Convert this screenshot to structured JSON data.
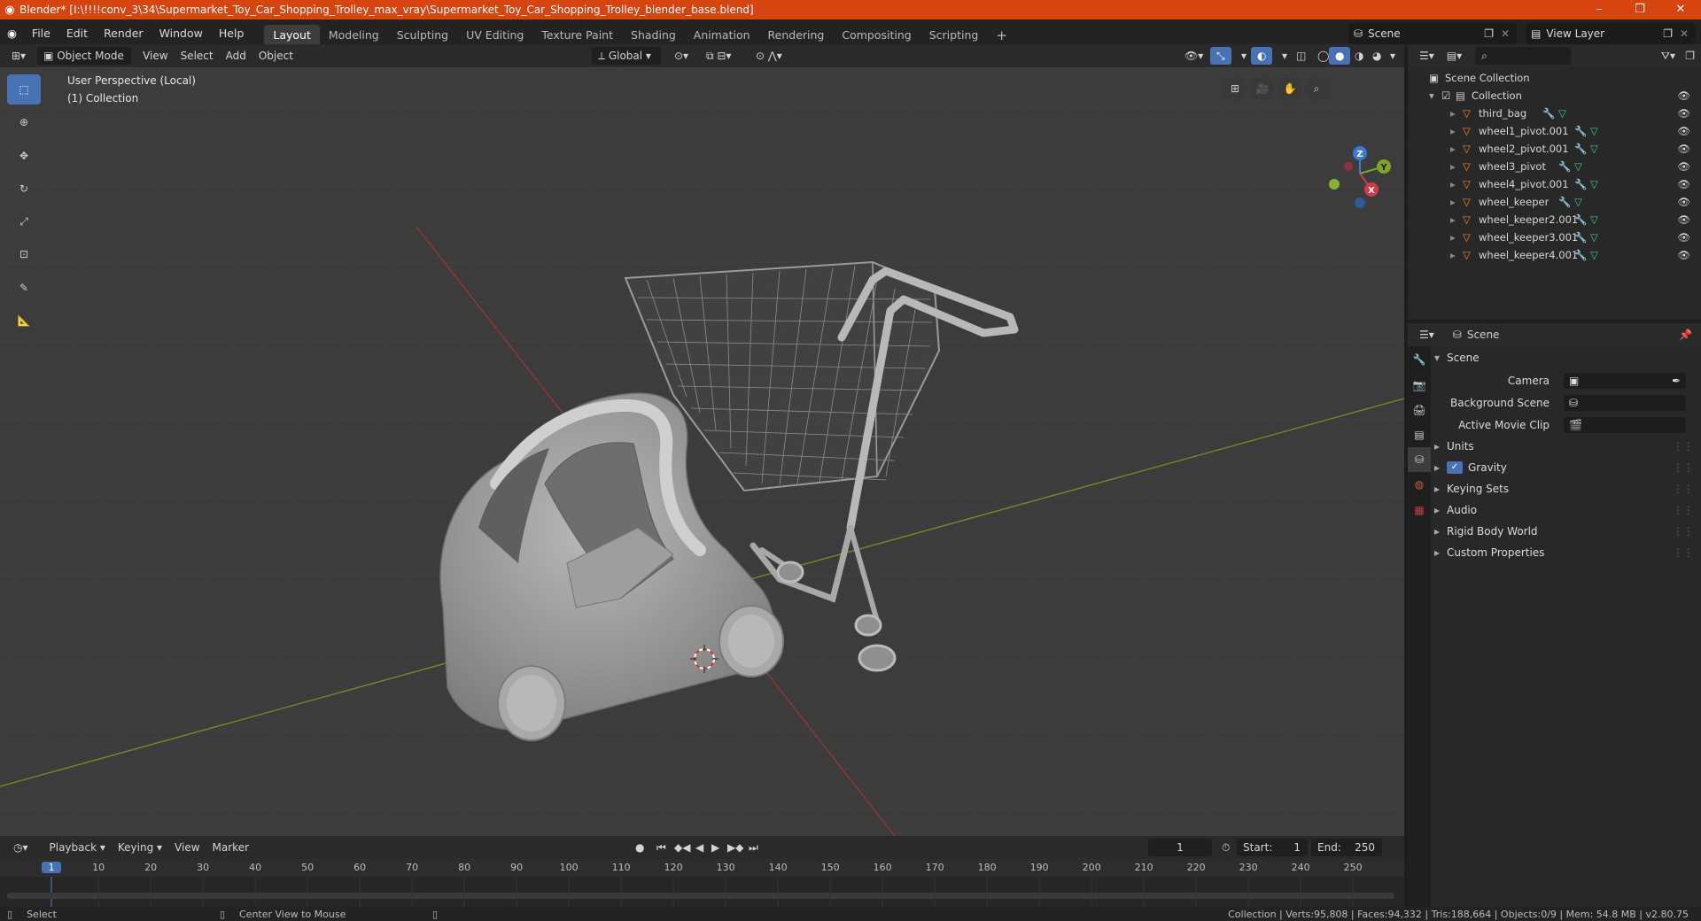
{
  "window": {
    "title": "Blender* [I:\\!!!!conv_3\\34\\Supermarket_Toy_Car_Shopping_Trolley_max_vray\\Supermarket_Toy_Car_Shopping_Trolley_blender_base.blend]",
    "minimize": "–",
    "maximize": "❐",
    "close": "✕"
  },
  "menu": [
    "File",
    "Edit",
    "Render",
    "Window",
    "Help"
  ],
  "workspaces": [
    {
      "label": "Layout",
      "active": true
    },
    {
      "label": "Modeling",
      "active": false
    },
    {
      "label": "Sculpting",
      "active": false
    },
    {
      "label": "UV Editing",
      "active": false
    },
    {
      "label": "Texture Paint",
      "active": false
    },
    {
      "label": "Shading",
      "active": false
    },
    {
      "label": "Animation",
      "active": false
    },
    {
      "label": "Rendering",
      "active": false
    },
    {
      "label": "Compositing",
      "active": false
    },
    {
      "label": "Scripting",
      "active": false
    }
  ],
  "add_workspace": "+",
  "scene_selector": "Scene",
  "view_layer": "View Layer",
  "viewport": {
    "mode": "Object Mode",
    "menus": [
      "View",
      "Select",
      "Add",
      "Object"
    ],
    "transform_orientation": "Global",
    "perspective_label": "User Perspective (Local)",
    "collection_label": "(1) Collection",
    "gizmo": {
      "x": "X",
      "y": "Y",
      "z": "Z"
    }
  },
  "timeline": {
    "menus": [
      "Playback",
      "Keying",
      "View",
      "Marker"
    ],
    "current_frame": "1",
    "start_label": "Start:",
    "start": "1",
    "end_label": "End:",
    "end": "250",
    "ticks": [
      "1",
      "10",
      "20",
      "30",
      "40",
      "50",
      "60",
      "70",
      "80",
      "90",
      "100",
      "110",
      "120",
      "130",
      "140",
      "150",
      "160",
      "170",
      "180",
      "190",
      "200",
      "210",
      "220",
      "230",
      "240",
      "250"
    ]
  },
  "statusbar": {
    "left": "Select",
    "middle": "Center View to Mouse",
    "right": "Collection | Verts:95,808 | Faces:94,332 | Tris:188,664 | Objects:0/9 | Mem: 54.8 MB | v2.80.75"
  },
  "outliner": {
    "root": "Scene Collection",
    "collection": "Collection",
    "items": [
      "third_bag",
      "wheel1_pivot.001",
      "wheel2_pivot.001",
      "wheel3_pivot",
      "wheel4_pivot.001",
      "wheel_keeper",
      "wheel_keeper2.001",
      "wheel_keeper3.001",
      "wheel_keeper4.001"
    ]
  },
  "properties": {
    "context": "Scene",
    "panel_title": "Scene",
    "fields": [
      {
        "label": "Camera"
      },
      {
        "label": "Background Scene"
      },
      {
        "label": "Active Movie Clip"
      }
    ],
    "sections": [
      {
        "label": "Units",
        "checkbox": false
      },
      {
        "label": "Gravity",
        "checkbox": true
      },
      {
        "label": "Keying Sets",
        "checkbox": false
      },
      {
        "label": "Audio",
        "checkbox": false
      },
      {
        "label": "Rigid Body World",
        "checkbox": false
      },
      {
        "label": "Custom Properties",
        "checkbox": false
      }
    ]
  },
  "colors": {
    "title_bar": "#d64410",
    "accent": "#4772b3",
    "x_axis": "#9a3434",
    "y_axis": "#6b8e23",
    "object_icon": "#e8893a",
    "mesh_icon": "#42c0a8",
    "modifier_icon": "#6f9ad8"
  }
}
